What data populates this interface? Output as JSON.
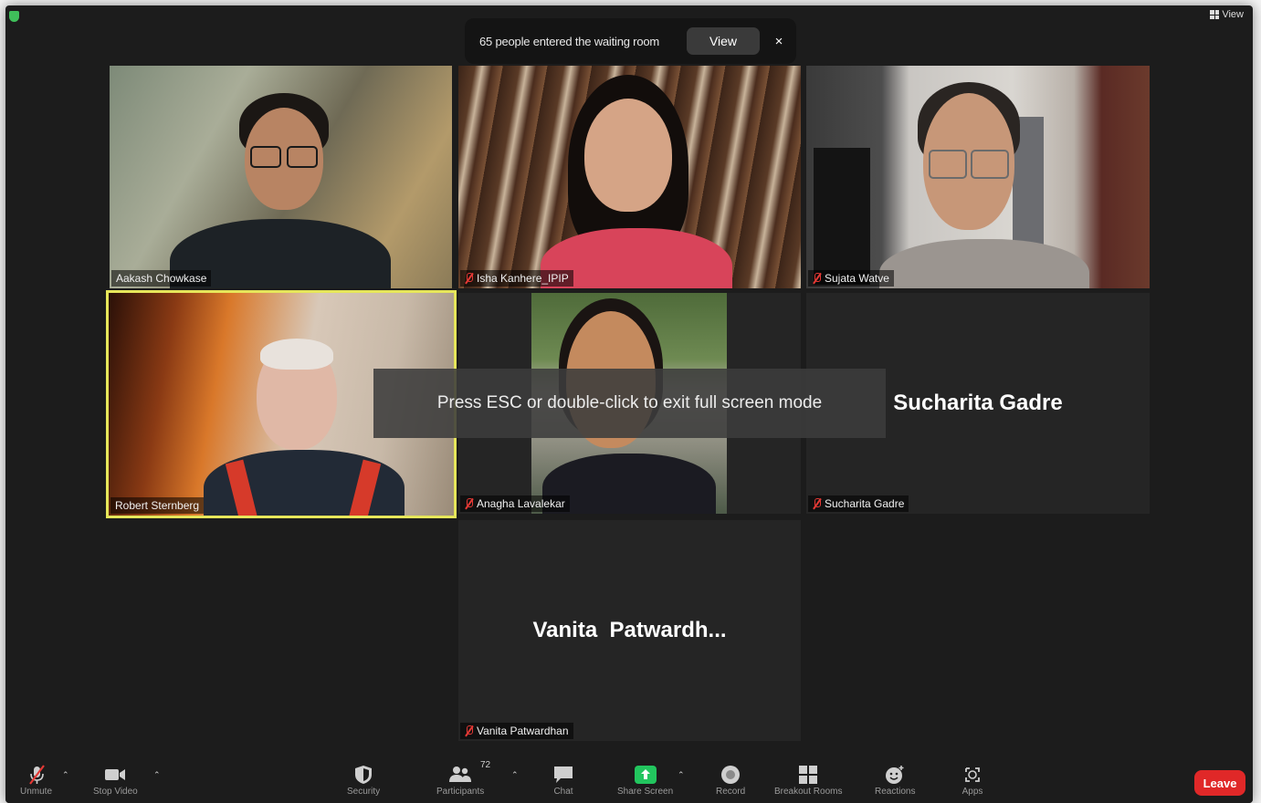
{
  "notification": {
    "text": "65 people entered the waiting room",
    "view_label": "View",
    "close_glyph": "×"
  },
  "top_right": {
    "view_label": "View"
  },
  "participants": [
    {
      "name": "Aakash Chowkase",
      "video": true,
      "muted": false
    },
    {
      "name": "Isha Kanhere_IPIP",
      "video": true,
      "muted": true
    },
    {
      "name": "Sujata Watve",
      "video": true,
      "muted": true
    },
    {
      "name": "Robert Sternberg",
      "video": true,
      "muted": false,
      "active_speaker": true
    },
    {
      "name": "Anagha Lavalekar",
      "video": true,
      "muted": true
    },
    {
      "name": "Sucharita Gadre",
      "video": false,
      "muted": true,
      "display_name": "Sucharita Gadre"
    },
    {
      "name": "Vanita Patwardhan",
      "video": false,
      "muted": true,
      "display_name": "Vanita  Patwardh..."
    }
  ],
  "overlay": {
    "text": "Press ESC or double-click to exit full screen mode"
  },
  "toolbar": {
    "unmute": "Unmute",
    "stop_video": "Stop Video",
    "security": "Security",
    "participants": "Participants",
    "participants_count": "72",
    "chat": "Chat",
    "share_screen": "Share Screen",
    "record": "Record",
    "breakout_rooms": "Breakout Rooms",
    "reactions": "Reactions",
    "apps": "Apps",
    "leave": "Leave"
  },
  "colors": {
    "active_speaker_border": "#e6e65a",
    "leave_button": "#e02828",
    "share_screen": "#22c55e",
    "muted_icon": "#e53935"
  }
}
